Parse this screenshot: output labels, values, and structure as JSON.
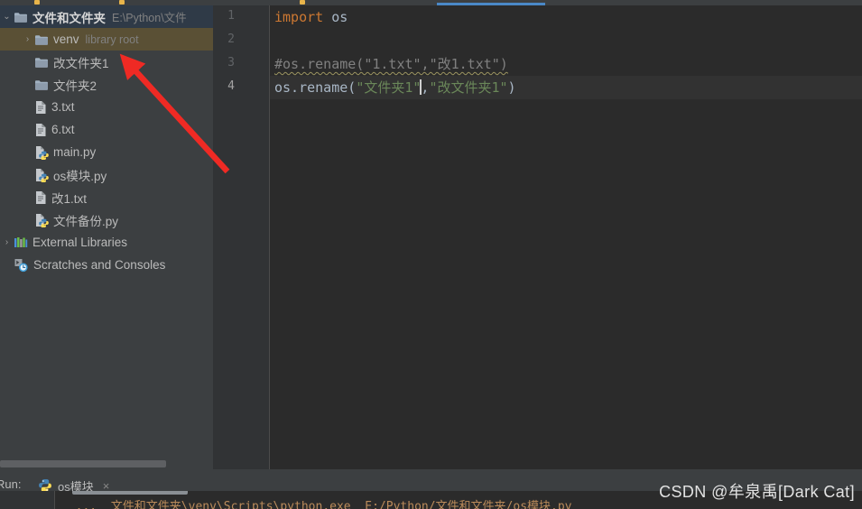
{
  "window": {
    "theme_bg": "#3c3f41",
    "editor_bg": "#2b2b2b",
    "accent_blue": "#4a88c7",
    "selection_blue": "#2f3a47",
    "hover_olive": "#5a5035"
  },
  "sidebar": {
    "items": [
      {
        "label": "文件和文件夹",
        "sub": "E:\\Python\\文件",
        "icon": "folder-icon",
        "arrow": "expanded",
        "indent": 1,
        "state": "selected",
        "bold": true
      },
      {
        "label": "venv",
        "sub": "library root",
        "icon": "folder-icon",
        "arrow": "collapsed",
        "indent": 2,
        "state": "hovered",
        "bold": false
      },
      {
        "label": "改文件夹1",
        "sub": "",
        "icon": "folder-icon",
        "arrow": "none",
        "indent": 2,
        "state": "normal",
        "bold": false
      },
      {
        "label": "文件夹2",
        "sub": "",
        "icon": "folder-icon",
        "arrow": "none",
        "indent": 2,
        "state": "normal",
        "bold": false
      },
      {
        "label": "3.txt",
        "sub": "",
        "icon": "text-file-icon",
        "arrow": "none",
        "indent": 2,
        "state": "normal",
        "bold": false
      },
      {
        "label": "6.txt",
        "sub": "",
        "icon": "text-file-icon",
        "arrow": "none",
        "indent": 2,
        "state": "normal",
        "bold": false
      },
      {
        "label": "main.py",
        "sub": "",
        "icon": "python-file-icon",
        "arrow": "none",
        "indent": 2,
        "state": "normal",
        "bold": false
      },
      {
        "label": "os模块.py",
        "sub": "",
        "icon": "python-file-icon",
        "arrow": "none",
        "indent": 2,
        "state": "normal",
        "bold": false
      },
      {
        "label": "改1.txt",
        "sub": "",
        "icon": "text-file-icon",
        "arrow": "none",
        "indent": 2,
        "state": "normal",
        "bold": false
      },
      {
        "label": "文件备份.py",
        "sub": "",
        "icon": "python-file-icon",
        "arrow": "none",
        "indent": 2,
        "state": "normal",
        "bold": false
      },
      {
        "label": "External Libraries",
        "sub": "",
        "icon": "external-libraries-icon",
        "arrow": "collapsed",
        "indent": 1,
        "state": "normal",
        "bold": false
      },
      {
        "label": "Scratches and Consoles",
        "sub": "",
        "icon": "scratches-icon",
        "arrow": "none",
        "indent": 1,
        "state": "normal",
        "bold": false
      }
    ]
  },
  "editor": {
    "line_numbers": [
      "1",
      "2",
      "3",
      "4"
    ],
    "current_line": 4,
    "lines": [
      {
        "n": 1,
        "tokens": [
          {
            "t": "import",
            "c": "kw"
          },
          {
            "t": " os",
            "c": "plain"
          }
        ]
      },
      {
        "n": 2,
        "tokens": []
      },
      {
        "n": 3,
        "tokens": [
          {
            "t": "#os.rename(\"1.txt\",\"改1.txt\")",
            "c": "comment-wavy"
          }
        ]
      },
      {
        "n": 4,
        "tokens": [
          {
            "t": "os.rename(",
            "c": "plain"
          },
          {
            "t": "\"文件夹1\"",
            "c": "str"
          },
          {
            "t": "CARET",
            "c": "caret"
          },
          {
            "t": ",",
            "c": "plain"
          },
          {
            "t": "\"改文件夹1\"",
            "c": "str"
          },
          {
            "t": ")",
            "c": "plain"
          }
        ]
      }
    ]
  },
  "run_panel": {
    "label": "Run:",
    "tab_label": "os模块",
    "tab_icon": "python-file-icon",
    "close_glyph": "×"
  },
  "console": {
    "output": "  ...  文件和文件夹\\venv\\Scripts\\python.exe  E:/Python/文件和文件夹/os模块.py"
  },
  "watermark": {
    "text": "CSDN @牟泉禹[Dark Cat]"
  },
  "annotation": {
    "arrow_color": "#ef2a24",
    "points_at": "改文件夹1"
  }
}
